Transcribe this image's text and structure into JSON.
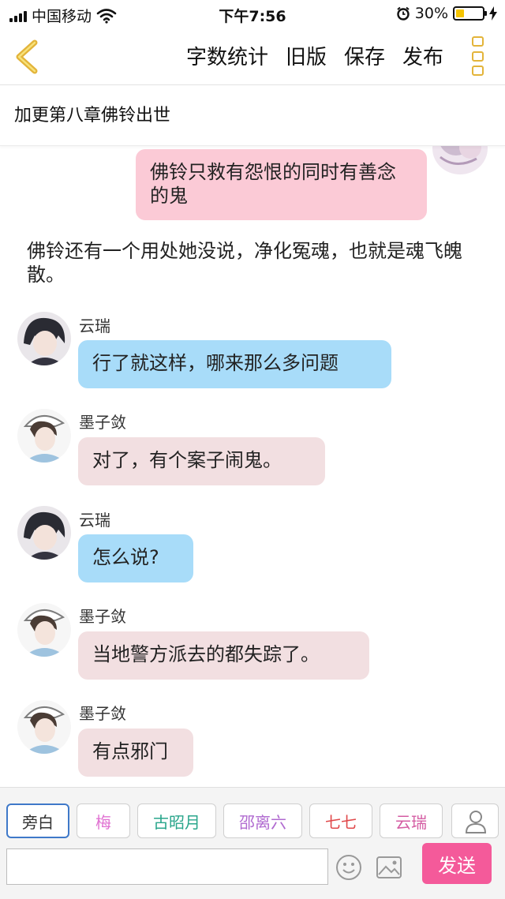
{
  "status": {
    "carrier": "中国移动",
    "time": "下午7:56",
    "battery": "30%"
  },
  "nav": {
    "word_count": "字数统计",
    "old_version": "旧版",
    "save": "保存",
    "publish": "发布"
  },
  "chapter_title": "加更第八章佛铃出世",
  "chat": {
    "messages": [
      {
        "speaker": "",
        "text": "佛铃只救有怨恨的同时有善念的鬼"
      },
      {
        "speaker": "",
        "text": "佛铃还有一个用处她没说，净化冤魂，也就是魂飞魄散。"
      },
      {
        "speaker": "云瑞",
        "text": "行了就这样，哪来那么多问题"
      },
      {
        "speaker": "墨子敛",
        "text": "对了，有个案子闹鬼。"
      },
      {
        "speaker": "云瑞",
        "text": "怎么说?"
      },
      {
        "speaker": "墨子敛",
        "text": "当地警方派去的都失踪了。"
      },
      {
        "speaker": "墨子敛",
        "text": "有点邪门"
      }
    ]
  },
  "characters": [
    {
      "label": "旁白",
      "color": "#333333"
    },
    {
      "label": "梅",
      "color": "#e071d2"
    },
    {
      "label": "古昭月",
      "color": "#2aa68c"
    },
    {
      "label": "邵离六",
      "color": "#b06ad0"
    },
    {
      "label": "七七",
      "color": "#e0484a"
    },
    {
      "label": "云瑞",
      "color": "#d45ca3"
    }
  ],
  "composer": {
    "placeholder": "",
    "send_label": "发送"
  },
  "colors": {
    "accent": "#f45a9a",
    "back_arrow": "#e3b43a",
    "bubble_self": "#fbcad6",
    "bubble_yunrui": "#a8dcf9",
    "bubble_mozilian": "#f2dfe1"
  }
}
